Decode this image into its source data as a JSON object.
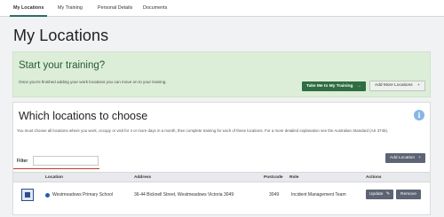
{
  "nav": {
    "tabs": [
      {
        "label": "My Locations",
        "active": true
      },
      {
        "label": "My Training",
        "active": false
      },
      {
        "label": "Personal Details",
        "active": false
      },
      {
        "label": "Documents",
        "active": false
      }
    ]
  },
  "page": {
    "title": "My Locations"
  },
  "start_training": {
    "title": "Start your training?",
    "description": "Once you're finished adding your work locations you can move on to your training.",
    "primary_button": "Take Me to My Training",
    "primary_icon": "→",
    "secondary_button": "Add More Locations",
    "secondary_icon": "+"
  },
  "locations": {
    "title": "Which locations to choose",
    "info_icon": "i",
    "description": "You must choose all locations where you work, occupy or visit for 4 or more days in a month, then complete training for each of these locations. For a more detailed explanation see the Australian Standard (AS 3745).",
    "filter_label": "Filter",
    "filter_value": "",
    "add_button": "Add Location",
    "add_icon": "+",
    "columns": {
      "location": "Location",
      "address": "Address",
      "postcode": "Postcode",
      "role": "Role",
      "actions": "Actions"
    },
    "rows": [
      {
        "location": "Westmeadows Primary School",
        "address": "36-44 Bicknell Street, Westmeadows Victoria 3049",
        "postcode": "3049",
        "role": "Incident Management Team",
        "update_label": "Update",
        "update_icon": "✎",
        "remove_label": "Remove"
      }
    ]
  },
  "colors": {
    "accent_green": "#2f6d43",
    "banner_bg": "#dcedd8",
    "action_button": "#5d6473",
    "tab_underline": "#2a6f67",
    "info_blue": "#86b6e6"
  }
}
